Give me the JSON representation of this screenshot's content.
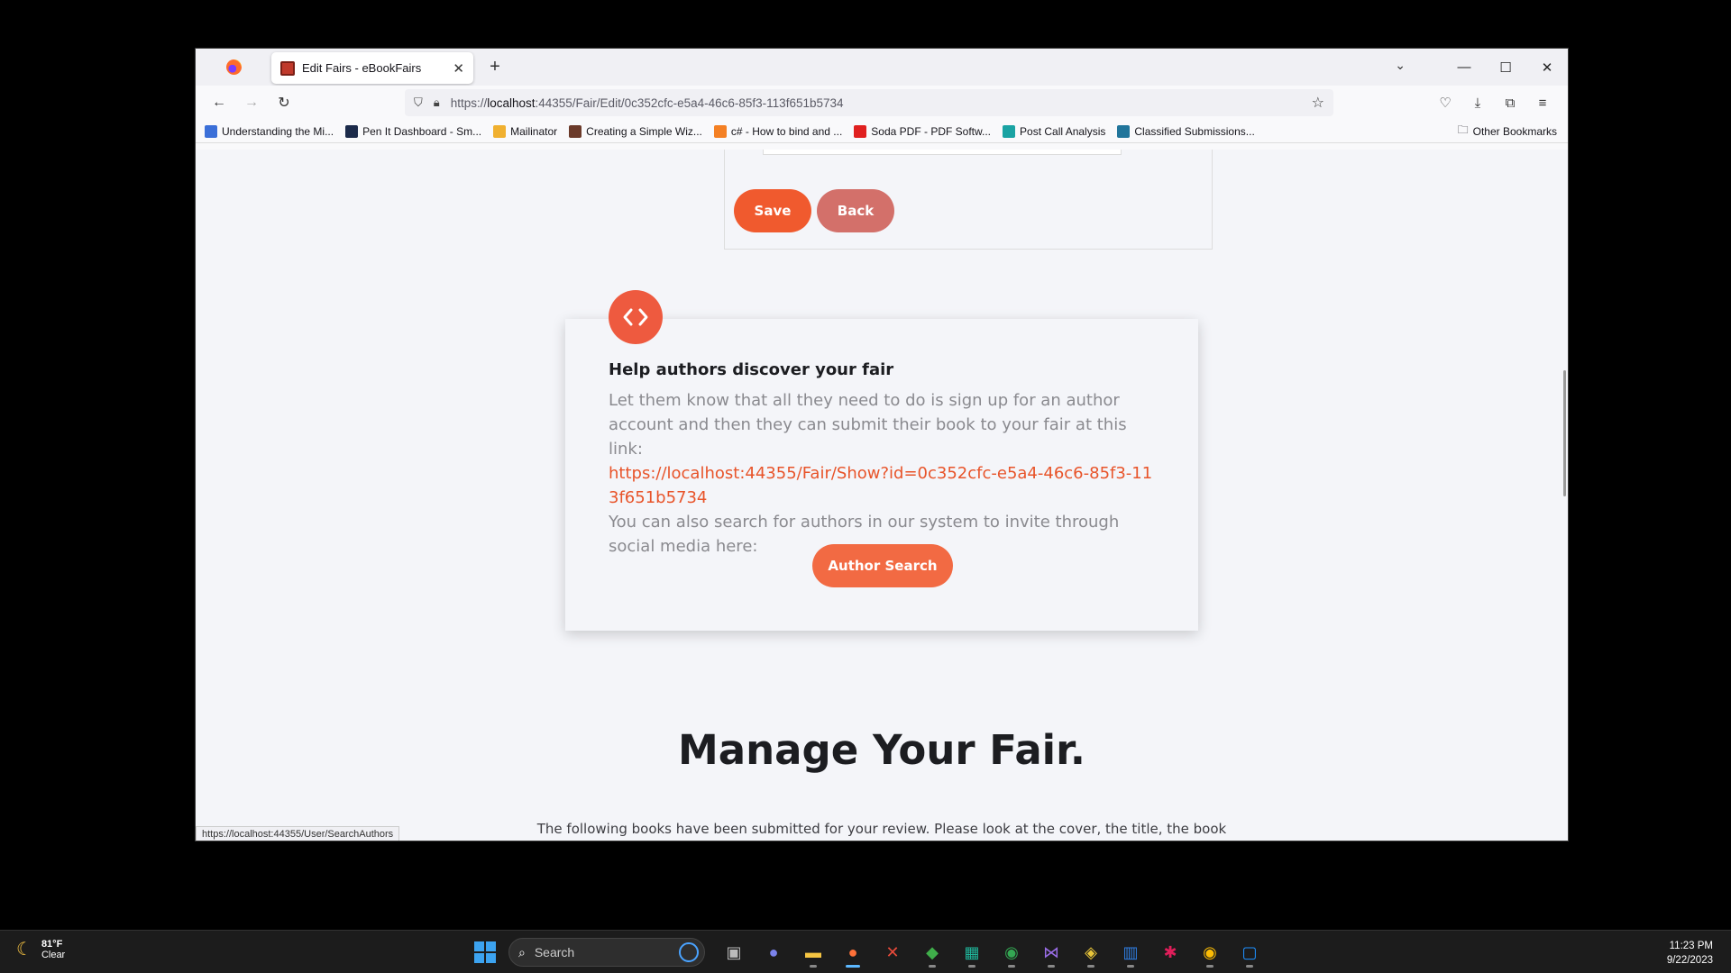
{
  "browser": {
    "tab_title": "Edit Fairs - eBookFairs",
    "new_tab": "+",
    "url_prefix": "https://",
    "url_host": "localhost",
    "url_rest": ":44355/Fair/Edit/0c352cfc-e5a4-46c6-85f3-113f651b5734",
    "bookmarks": [
      {
        "label": "Understanding the Mi...",
        "color": "#3b6fd8"
      },
      {
        "label": "Pen It Dashboard - Sm...",
        "color": "#1b2a4a"
      },
      {
        "label": "Mailinator",
        "color": "#f0b030"
      },
      {
        "label": "Creating a Simple Wiz...",
        "color": "#6b3a2a"
      },
      {
        "label": "c# - How to bind and ...",
        "color": "#f48024"
      },
      {
        "label": "Soda PDF - PDF Softw...",
        "color": "#e02020"
      },
      {
        "label": "Post Call Analysis",
        "color": "#1aa3a3"
      },
      {
        "label": "Classified Submissions...",
        "color": "#21759b"
      }
    ],
    "other_bookmarks": "Other Bookmarks",
    "status_url": "https://localhost:44355/User/SearchAuthors"
  },
  "form": {
    "save_label": "Save",
    "back_label": "Back"
  },
  "help": {
    "title": "Help authors discover your fair",
    "text1": "Let them know that all they need to do is sign up for an author account and then they can submit their book to your fair at this link:",
    "link": "https://localhost:44355/Fair/Show?id=0c352cfc-e5a4-46c6-85f3-113f651b5734",
    "text2": "You can also search for authors in our system to invite through social media here:",
    "author_search_label": "Author Search"
  },
  "manage": {
    "title": "Manage Your Fair.",
    "desc": "The following books have been submitted for your review. Please look at the cover, the title, the book"
  },
  "taskbar": {
    "temperature": "81°F",
    "condition": "Clear",
    "search_placeholder": "Search",
    "time": "11:23 PM",
    "date": "9/22/2023"
  },
  "colors": {
    "accent": "#f05a2e",
    "back": "#d3706a",
    "link": "#e8542a"
  }
}
